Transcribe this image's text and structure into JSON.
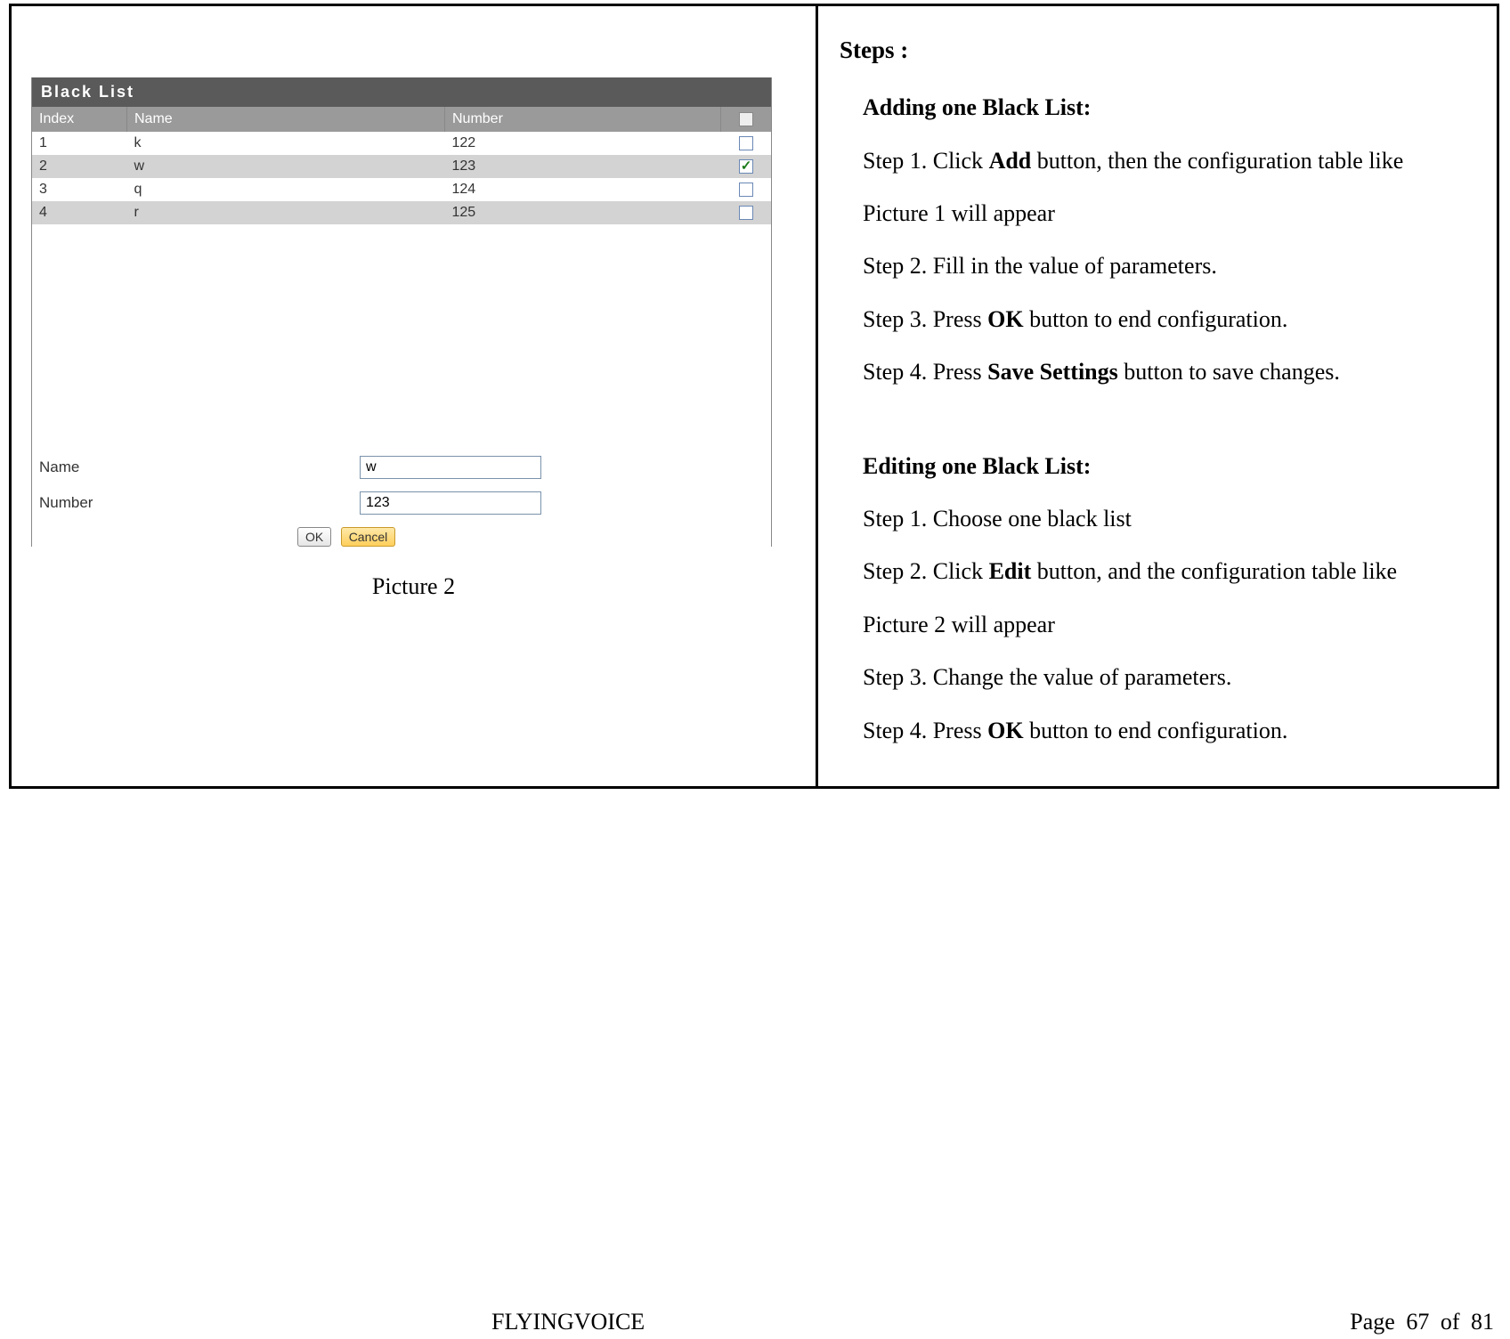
{
  "panel": {
    "title": "Black List",
    "headers": {
      "index": "Index",
      "name": "Name",
      "number": "Number"
    },
    "rows": [
      {
        "index": "1",
        "name": "k",
        "number": "122",
        "checked": false
      },
      {
        "index": "2",
        "name": "w",
        "number": "123",
        "checked": true
      },
      {
        "index": "3",
        "name": "q",
        "number": "124",
        "checked": false
      },
      {
        "index": "4",
        "name": "r",
        "number": "125",
        "checked": false
      }
    ],
    "form": {
      "name_label": "Name",
      "name_value": "w",
      "number_label": "Number",
      "number_value": "123",
      "ok_label": "OK",
      "cancel_label": "Cancel"
    },
    "caption": "Picture 2"
  },
  "steps": {
    "heading": "Steps :",
    "add_heading": "Adding one Black List:",
    "add": {
      "s1a": "Step 1. Click ",
      "s1b": "Add",
      "s1c": " button, then the configuration table like",
      "s1d": "Picture 1 will appear",
      "s2": "Step 2. Fill in the value of parameters.",
      "s3a": "Step 3. Press ",
      "s3b": "OK",
      "s3c": " button to end configuration.",
      "s4a": "Step 4. Press ",
      "s4b": "Save Settings",
      "s4c": " button to save changes."
    },
    "edit_heading": "Editing one Black List:",
    "edit": {
      "s1": "Step 1. Choose one black list",
      "s2a": "Step 2. Click ",
      "s2b": "Edit",
      "s2c": " button, and the configuration table like",
      "s2d": "Picture 2 will appear",
      "s3": "Step 3. Change the value of parameters.",
      "s4a": "Step 4. Press ",
      "s4b": "OK",
      "s4c": " button to end configuration."
    }
  },
  "footer": {
    "brand": "FLYINGVOICE",
    "page": "Page 67 of 81"
  }
}
